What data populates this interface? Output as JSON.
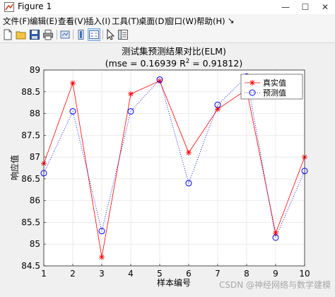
{
  "window": {
    "title": "Figure 1",
    "minimize": "—",
    "maximize": "☐",
    "close": "✕"
  },
  "menu": {
    "items": [
      "文件(F)",
      "编辑(E)",
      "查看(V)",
      "插入(I)",
      "工具(T)",
      "桌面(D)",
      "窗口(W)",
      "帮助(H)"
    ],
    "arrow": "↘"
  },
  "toolbar": {
    "icons": [
      "new-figure-icon",
      "open-file-icon",
      "save-icon",
      "print-icon",
      "link-plot-icon",
      "insert-colorbar-icon",
      "insert-legend-icon",
      "edit-plot-icon",
      "property-inspector-icon"
    ]
  },
  "watermark": "CSDN @神经网络与数学建模",
  "chart_data": {
    "type": "line",
    "title_line1": "测试集预测结果对比(ELM)",
    "title_line2_prefix": "(mse = 0.16939 R",
    "title_line2_sup": "2",
    "title_line2_suffix": " = 0.91812)",
    "xlabel": "样本编号",
    "ylabel": "响应值",
    "x": [
      1,
      2,
      3,
      4,
      5,
      6,
      7,
      8,
      9,
      10
    ],
    "xlim": [
      1,
      10
    ],
    "ylim": [
      84.5,
      89
    ],
    "xticks": [
      "1",
      "2",
      "3",
      "4",
      "5",
      "6",
      "7",
      "8",
      "9",
      "10"
    ],
    "yticks": [
      "84.5",
      "85",
      "85.5",
      "86",
      "86.5",
      "87",
      "87.5",
      "88",
      "88.5",
      "89"
    ],
    "grid": true,
    "legend_position": "top-right",
    "series": [
      {
        "name": "真实值",
        "marker": "*",
        "line": "solid",
        "color": "#ff0000",
        "values": [
          86.85,
          88.7,
          84.7,
          88.45,
          88.75,
          87.1,
          88.1,
          88.55,
          85.25,
          87.0
        ]
      },
      {
        "name": "预测值",
        "marker": "o",
        "line": "dotted",
        "color": "#0000ff",
        "values": [
          86.63,
          88.05,
          85.3,
          88.05,
          88.78,
          86.4,
          88.2,
          88.85,
          85.15,
          86.68
        ]
      }
    ]
  }
}
